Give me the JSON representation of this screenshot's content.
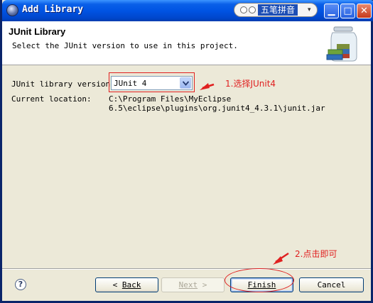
{
  "window": {
    "title": "Add Library",
    "icon": "eclipse-icon",
    "buttons": [
      "minimize-icon",
      "maximize-icon",
      "close-icon"
    ]
  },
  "ime": {
    "label": "五笔拼音"
  },
  "header": {
    "title": "JUnit Library",
    "description": "Select the JUnit version to use in this project."
  },
  "form": {
    "version_label": "JUnit library version:",
    "version_value": "JUnit 4",
    "location_label": "Current location:",
    "location_line1": "C:\\Program Files\\MyEclipse",
    "location_line2": "6.5\\eclipse\\plugins\\org.junit4_4.3.1\\junit.jar"
  },
  "annotations": {
    "step1": "1.选择JUnit4",
    "step2": "2.点击即可",
    "color": "#e02020"
  },
  "footer": {
    "help": "?",
    "back": "Back",
    "next": "Next",
    "finish": "Finish",
    "cancel": "Cancel"
  }
}
